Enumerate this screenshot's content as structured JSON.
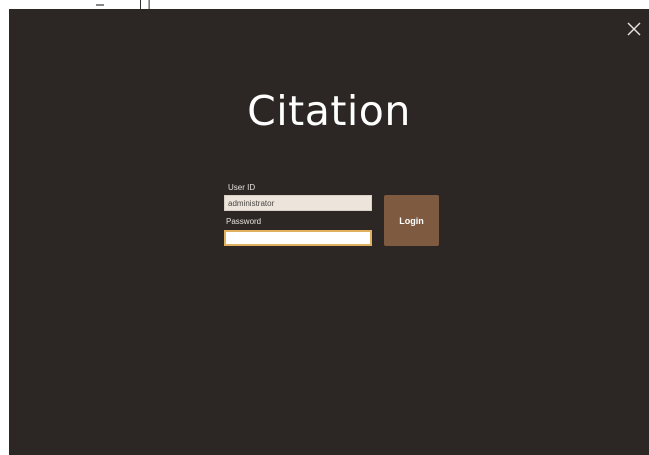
{
  "titlebar": {
    "glyph_left": "⎯",
    "glyph_right": "⎕"
  },
  "app": {
    "brand": "Citation",
    "background_color": "#2c2624",
    "accent_color": "#7e5a40",
    "close_icon": "close-icon"
  },
  "login": {
    "userid_label": "User ID",
    "userid_value": "administrator",
    "password_label": "Password",
    "password_value": "",
    "submit_label": "Login"
  }
}
